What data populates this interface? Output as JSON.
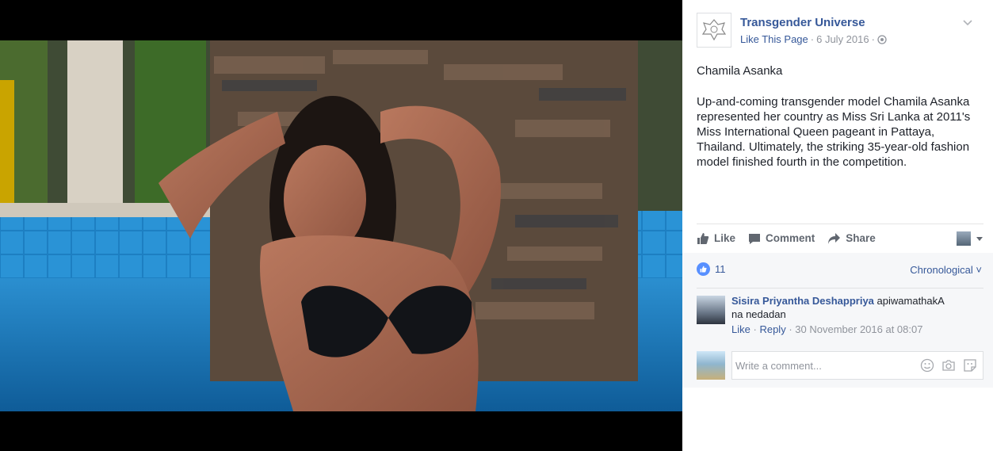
{
  "photo": {
    "subject": "post-photo"
  },
  "post": {
    "page_name": "Transgender Universe",
    "like_page": "Like This Page",
    "date": "6 July 2016",
    "separator": "·",
    "title": "Chamila Asanka",
    "body": "Up-and-coming transgender model Chamila Asanka represented her country as Miss Sri Lanka at 2011's Miss International Queen pageant in Pattaya, Thailand. Ultimately, the striking 35-year-old fashion model finished fourth in the competition."
  },
  "actions": {
    "like": "Like",
    "comment": "Comment",
    "share": "Share"
  },
  "reactions": {
    "count": "11",
    "order": "Chronological"
  },
  "comments": [
    {
      "author": "Sisira Priyantha Deshappriya",
      "text": "apiwamathakA na nedadan",
      "like": "Like",
      "reply": "Reply",
      "timestamp": "30 November 2016 at 08:07"
    }
  ],
  "composer": {
    "placeholder": "Write a comment..."
  },
  "colors": {
    "link": "#365899",
    "muted": "#90949c",
    "text": "#1d2129",
    "pool": "#1b6da6"
  }
}
